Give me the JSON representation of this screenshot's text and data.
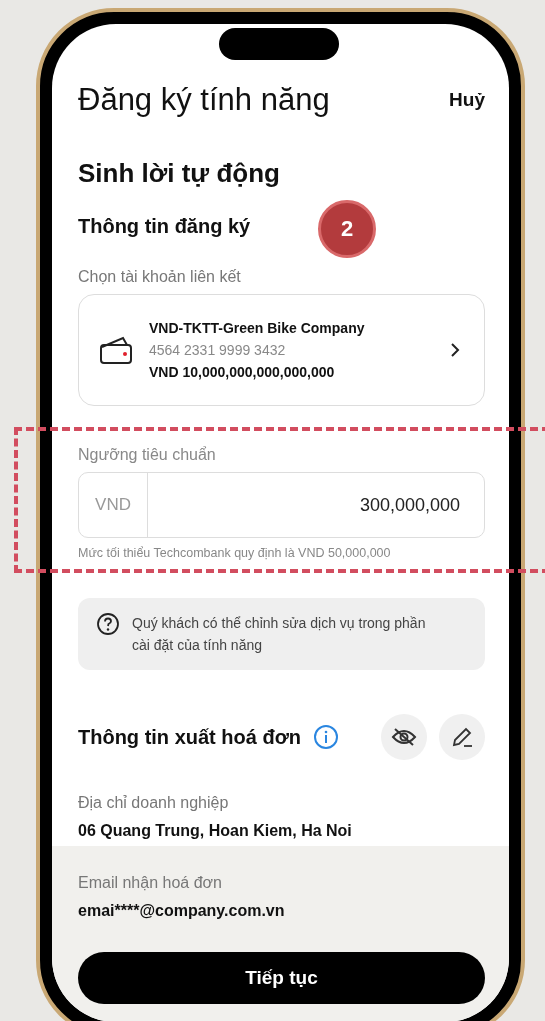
{
  "header": {
    "title": "Đăng ký tính năng",
    "cancel": "Huỷ"
  },
  "section_title": "Sinh lời tự động",
  "registration": {
    "heading": "Thông tin đăng ký",
    "step_badge": "2",
    "account_label": "Chọn tài khoản liên kết",
    "account": {
      "name": "VND-TKTT-Green Bike Company",
      "number": "4564 2331 9999 3432",
      "balance": "VND 10,000,000,000,000,000"
    },
    "threshold_label": "Ngưỡng tiêu chuẩn",
    "threshold_currency": "VND",
    "threshold_value": "300,000,000",
    "threshold_hint": "Mức tối thiểu Techcombank quy định là VND 50,000,000"
  },
  "notice": "Quý khách có thể chỉnh sửa dịch vụ trong phần cài đặt của tính năng",
  "invoice": {
    "heading": "Thông tin xuất hoá đơn",
    "fields": [
      {
        "label": "Địa chỉ doanh nghiệp",
        "value": "06 Quang Trung, Hoan Kiem, Ha Noi"
      },
      {
        "label": "Email nhận hoá đơn",
        "value": "emai****@company.com.vn"
      }
    ]
  },
  "continue_button": "Tiếp tục"
}
